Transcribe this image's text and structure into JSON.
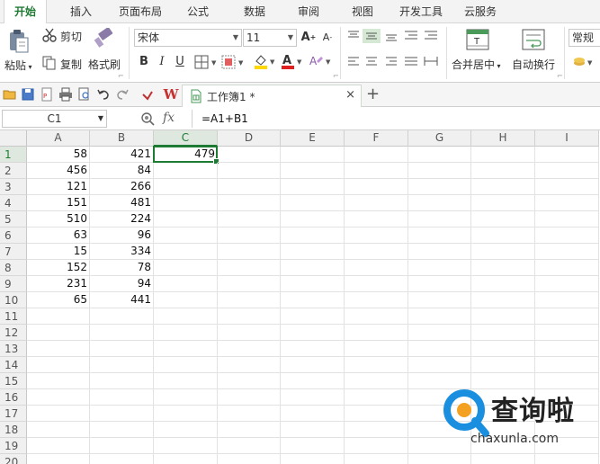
{
  "menu": {
    "tabs": [
      "开始",
      "插入",
      "页面布局",
      "公式",
      "数据",
      "审阅",
      "视图",
      "开发工具",
      "云服务"
    ],
    "active": "开始"
  },
  "ribbon": {
    "paste": "粘贴",
    "cut": "剪切",
    "copy": "复制",
    "format_painter": "格式刷",
    "font_name": "宋体",
    "font_size": "11",
    "bold": "B",
    "italic": "I",
    "underline": "U",
    "merge_center": "合并居中",
    "wrap_text": "自动换行",
    "number_format": "常规",
    "font_color": "#e02020",
    "fill_color": "#ffd800"
  },
  "doc": {
    "tab_title": "工作簿1 *",
    "close": "×",
    "new_tab": "+",
    "app_letter": "W"
  },
  "formula_bar": {
    "name_box": "C1",
    "fx": "fx",
    "formula": "=A1+B1"
  },
  "sheet": {
    "columns": [
      "A",
      "B",
      "C",
      "D",
      "E",
      "F",
      "G",
      "H",
      "I"
    ],
    "selected_column": "C",
    "selected_row": 1,
    "rows": [
      "1",
      "2",
      "3",
      "4",
      "5",
      "6",
      "7",
      "8",
      "9",
      "10",
      "11",
      "12",
      "13",
      "14",
      "15",
      "16",
      "17",
      "18",
      "19",
      "20"
    ],
    "data": [
      [
        "58",
        "421",
        "479"
      ],
      [
        "456",
        "84",
        ""
      ],
      [
        "121",
        "266",
        ""
      ],
      [
        "151",
        "481",
        ""
      ],
      [
        "510",
        "224",
        ""
      ],
      [
        "63",
        "96",
        ""
      ],
      [
        "15",
        "334",
        ""
      ],
      [
        "152",
        "78",
        ""
      ],
      [
        "231",
        "94",
        ""
      ],
      [
        "65",
        "441",
        ""
      ]
    ],
    "accent": "#1e7b34"
  },
  "watermark": {
    "name": "查询啦",
    "url": "chaxunla.com",
    "color": "#1a8fe0"
  }
}
